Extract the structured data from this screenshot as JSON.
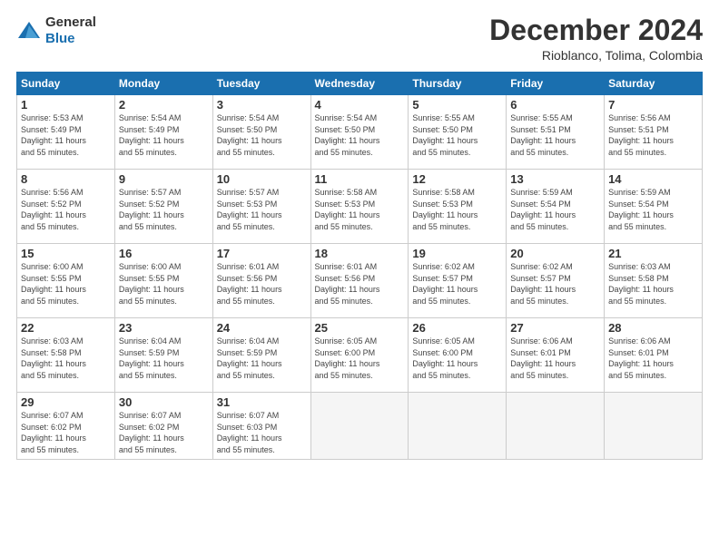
{
  "header": {
    "logo_general": "General",
    "logo_blue": "Blue",
    "title": "December 2024",
    "location": "Rioblanco, Tolima, Colombia"
  },
  "days_of_week": [
    "Sunday",
    "Monday",
    "Tuesday",
    "Wednesday",
    "Thursday",
    "Friday",
    "Saturday"
  ],
  "weeks": [
    [
      {
        "day": "1",
        "sunrise": "5:53 AM",
        "sunset": "5:49 PM",
        "daylight": "11 hours and 55 minutes."
      },
      {
        "day": "2",
        "sunrise": "5:54 AM",
        "sunset": "5:49 PM",
        "daylight": "11 hours and 55 minutes."
      },
      {
        "day": "3",
        "sunrise": "5:54 AM",
        "sunset": "5:50 PM",
        "daylight": "11 hours and 55 minutes."
      },
      {
        "day": "4",
        "sunrise": "5:54 AM",
        "sunset": "5:50 PM",
        "daylight": "11 hours and 55 minutes."
      },
      {
        "day": "5",
        "sunrise": "5:55 AM",
        "sunset": "5:50 PM",
        "daylight": "11 hours and 55 minutes."
      },
      {
        "day": "6",
        "sunrise": "5:55 AM",
        "sunset": "5:51 PM",
        "daylight": "11 hours and 55 minutes."
      },
      {
        "day": "7",
        "sunrise": "5:56 AM",
        "sunset": "5:51 PM",
        "daylight": "11 hours and 55 minutes."
      }
    ],
    [
      {
        "day": "8",
        "sunrise": "5:56 AM",
        "sunset": "5:52 PM",
        "daylight": "11 hours and 55 minutes."
      },
      {
        "day": "9",
        "sunrise": "5:57 AM",
        "sunset": "5:52 PM",
        "daylight": "11 hours and 55 minutes."
      },
      {
        "day": "10",
        "sunrise": "5:57 AM",
        "sunset": "5:53 PM",
        "daylight": "11 hours and 55 minutes."
      },
      {
        "day": "11",
        "sunrise": "5:58 AM",
        "sunset": "5:53 PM",
        "daylight": "11 hours and 55 minutes."
      },
      {
        "day": "12",
        "sunrise": "5:58 AM",
        "sunset": "5:53 PM",
        "daylight": "11 hours and 55 minutes."
      },
      {
        "day": "13",
        "sunrise": "5:59 AM",
        "sunset": "5:54 PM",
        "daylight": "11 hours and 55 minutes."
      },
      {
        "day": "14",
        "sunrise": "5:59 AM",
        "sunset": "5:54 PM",
        "daylight": "11 hours and 55 minutes."
      }
    ],
    [
      {
        "day": "15",
        "sunrise": "6:00 AM",
        "sunset": "5:55 PM",
        "daylight": "11 hours and 55 minutes."
      },
      {
        "day": "16",
        "sunrise": "6:00 AM",
        "sunset": "5:55 PM",
        "daylight": "11 hours and 55 minutes."
      },
      {
        "day": "17",
        "sunrise": "6:01 AM",
        "sunset": "5:56 PM",
        "daylight": "11 hours and 55 minutes."
      },
      {
        "day": "18",
        "sunrise": "6:01 AM",
        "sunset": "5:56 PM",
        "daylight": "11 hours and 55 minutes."
      },
      {
        "day": "19",
        "sunrise": "6:02 AM",
        "sunset": "5:57 PM",
        "daylight": "11 hours and 55 minutes."
      },
      {
        "day": "20",
        "sunrise": "6:02 AM",
        "sunset": "5:57 PM",
        "daylight": "11 hours and 55 minutes."
      },
      {
        "day": "21",
        "sunrise": "6:03 AM",
        "sunset": "5:58 PM",
        "daylight": "11 hours and 55 minutes."
      }
    ],
    [
      {
        "day": "22",
        "sunrise": "6:03 AM",
        "sunset": "5:58 PM",
        "daylight": "11 hours and 55 minutes."
      },
      {
        "day": "23",
        "sunrise": "6:04 AM",
        "sunset": "5:59 PM",
        "daylight": "11 hours and 55 minutes."
      },
      {
        "day": "24",
        "sunrise": "6:04 AM",
        "sunset": "5:59 PM",
        "daylight": "11 hours and 55 minutes."
      },
      {
        "day": "25",
        "sunrise": "6:05 AM",
        "sunset": "6:00 PM",
        "daylight": "11 hours and 55 minutes."
      },
      {
        "day": "26",
        "sunrise": "6:05 AM",
        "sunset": "6:00 PM",
        "daylight": "11 hours and 55 minutes."
      },
      {
        "day": "27",
        "sunrise": "6:06 AM",
        "sunset": "6:01 PM",
        "daylight": "11 hours and 55 minutes."
      },
      {
        "day": "28",
        "sunrise": "6:06 AM",
        "sunset": "6:01 PM",
        "daylight": "11 hours and 55 minutes."
      }
    ],
    [
      {
        "day": "29",
        "sunrise": "6:07 AM",
        "sunset": "6:02 PM",
        "daylight": "11 hours and 55 minutes."
      },
      {
        "day": "30",
        "sunrise": "6:07 AM",
        "sunset": "6:02 PM",
        "daylight": "11 hours and 55 minutes."
      },
      {
        "day": "31",
        "sunrise": "6:07 AM",
        "sunset": "6:03 PM",
        "daylight": "11 hours and 55 minutes."
      },
      null,
      null,
      null,
      null
    ]
  ]
}
